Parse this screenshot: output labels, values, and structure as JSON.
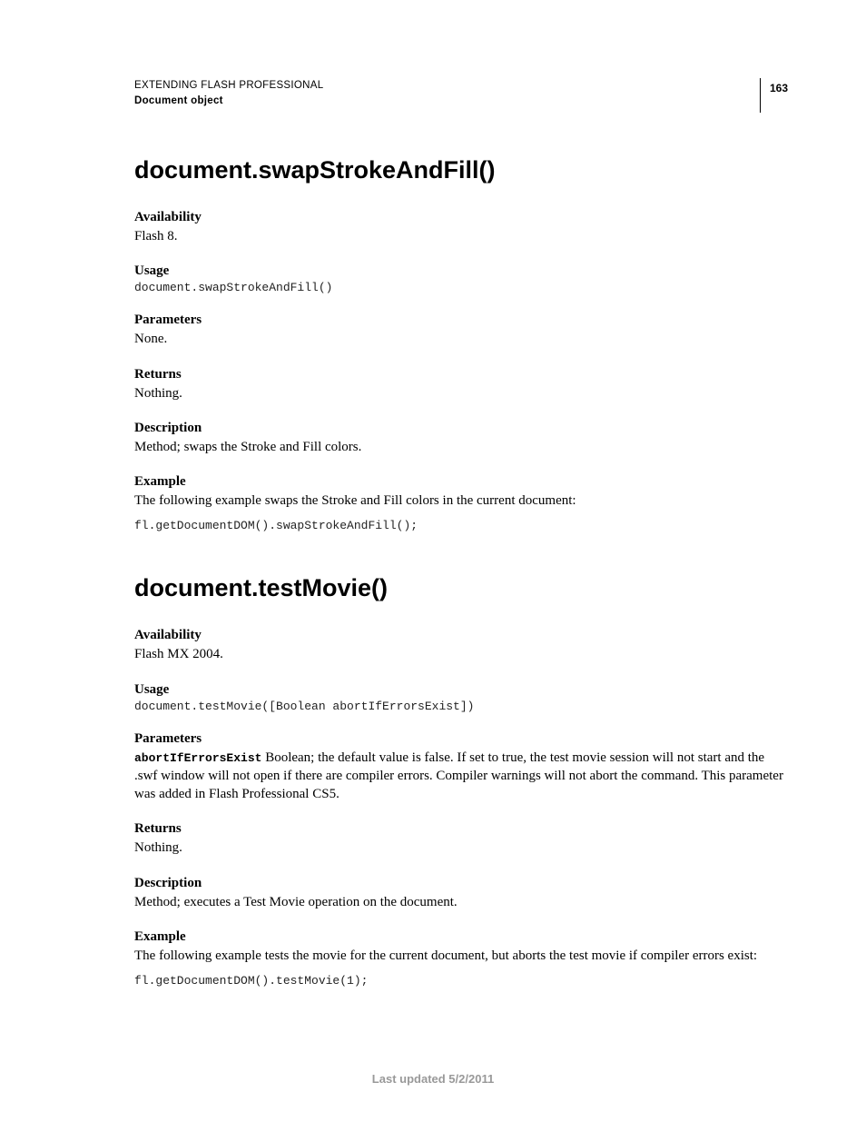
{
  "header": {
    "book": "EXTENDING FLASH PROFESSIONAL",
    "section": "Document object",
    "page_number": "163"
  },
  "entries": [
    {
      "title": "document.swapStrokeAndFill()",
      "availability_h": "Availability",
      "availability_v": "Flash 8.",
      "usage_h": "Usage",
      "usage_code": "document.swapStrokeAndFill()",
      "params_h": "Parameters",
      "params_v": "None.",
      "returns_h": "Returns",
      "returns_v": "Nothing.",
      "desc_h": "Description",
      "desc_v": "Method; swaps the Stroke and Fill colors.",
      "example_h": "Example",
      "example_v": "The following example swaps the Stroke and Fill colors in the current document:",
      "example_code": "fl.getDocumentDOM().swapStrokeAndFill();"
    },
    {
      "title": "document.testMovie()",
      "availability_h": "Availability",
      "availability_v": "Flash MX 2004.",
      "usage_h": "Usage",
      "usage_code": "document.testMovie([Boolean abortIfErrorsExist])",
      "params_h": "Parameters",
      "param_name": "abortIfErrorsExist",
      "param_desc": "  Boolean; the default value is false. If set to true, the test movie session will not start and the .swf window will not open if there are compiler errors. Compiler warnings will not abort the command. This parameter was added in Flash Professional CS5.",
      "returns_h": "Returns",
      "returns_v": "Nothing.",
      "desc_h": "Description",
      "desc_v": "Method; executes a Test Movie operation on the document.",
      "example_h": "Example",
      "example_v": "The following example tests the movie for the current document, but aborts the test movie if compiler errors exist:",
      "example_code": "fl.getDocumentDOM().testMovie(1);"
    }
  ],
  "footer": "Last updated 5/2/2011"
}
